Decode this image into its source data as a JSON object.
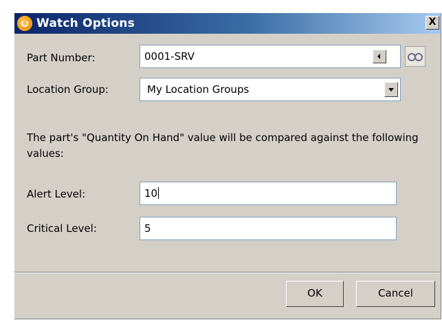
{
  "window": {
    "title": "Watch Options",
    "close_label": "X"
  },
  "form": {
    "part_number_label": "Part Number:",
    "part_number_value": "0001-SRV",
    "location_group_label": "Location Group:",
    "location_group_value": "My Location Groups",
    "description": "The part's \"Quantity On Hand\" value will be compared against the following values:",
    "alert_level_label": "Alert Level:",
    "alert_level_value": "10",
    "critical_level_label": "Critical Level:",
    "critical_level_value": "5"
  },
  "buttons": {
    "ok_label": "OK",
    "cancel_label": "Cancel"
  },
  "icons": {
    "app": "app-logo-icon",
    "scroll": "scroll-left-arrow-icon",
    "lookup": "binoculars-icon",
    "dropdown": "chevron-down-icon"
  }
}
